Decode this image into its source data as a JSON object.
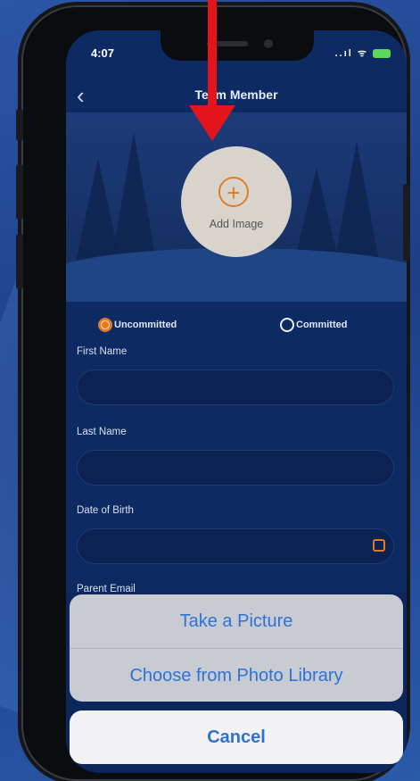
{
  "status": {
    "time": "4:07",
    "signal_icons": "..ıl ᯤ"
  },
  "nav": {
    "title": "Team Member",
    "back_glyph": "‹"
  },
  "hero": {
    "add_image_label": "Add Image",
    "plus_glyph": "+"
  },
  "status_options": [
    {
      "label": "Uncommitted",
      "selected": true
    },
    {
      "label": "Committed",
      "selected": false
    }
  ],
  "fields": {
    "first_name": "First Name",
    "last_name": "Last Name",
    "date_of_birth": "Date of Birth",
    "parent_email": "Parent Email"
  },
  "action_sheet": {
    "take_picture": "Take a Picture",
    "choose_library": "Choose from Photo Library",
    "cancel": "Cancel"
  },
  "colors": {
    "accent": "#e07c24",
    "ios_blue": "#2f72d6",
    "arrow": "#e4141b"
  }
}
